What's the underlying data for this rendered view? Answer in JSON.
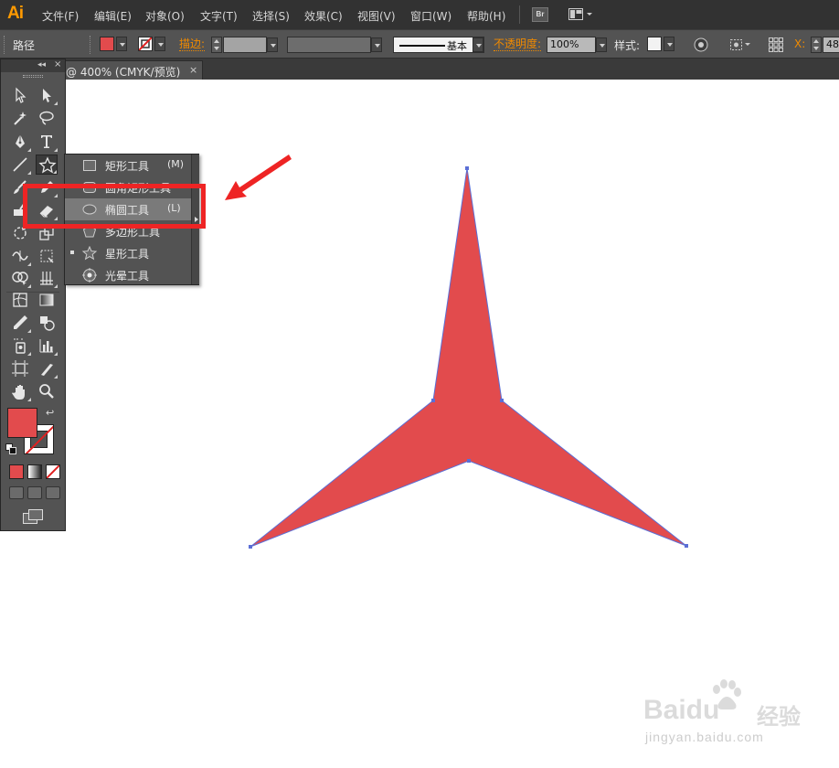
{
  "app": {
    "logo": "Ai"
  },
  "menubar": {
    "items": [
      "文件(F)",
      "编辑(E)",
      "对象(O)",
      "文字(T)",
      "选择(S)",
      "效果(C)",
      "视图(V)",
      "窗口(W)",
      "帮助(H)"
    ],
    "bridge_label": "Br"
  },
  "controlbar": {
    "selection_type": "路径",
    "fill_color": "#e24b4d",
    "stroke_label": "描边:",
    "stroke_profile": "基本",
    "opacity_label": "不透明度:",
    "opacity_value": "100%",
    "style_label": "样式:",
    "x_label": "X:",
    "x_value": "48"
  },
  "document": {
    "tab_title": "@ 400% (CMYK/预览)",
    "tab_close": "×"
  },
  "toolpanel": {
    "collapse": "◂◂",
    "close": "×",
    "fill_color": "#e24b4d",
    "tools": [
      "selection-tool",
      "direct-selection-tool",
      "magic-wand-tool",
      "lasso-tool",
      "pen-tool",
      "type-tool",
      "line-segment-tool",
      "star-tool",
      "paintbrush-tool",
      "pencil-tool",
      "blob-brush-tool",
      "eraser-tool",
      "rotate-tool",
      "scale-tool",
      "width-tool",
      "free-transform-tool",
      "shape-builder-tool",
      "graph-tool",
      "mesh-tool",
      "gradient-tool",
      "eyedropper-tool",
      "blend-tool",
      "symbol-sprayer-tool",
      "column-graph-tool",
      "artboard-tool",
      "slice-tool",
      "hand-tool",
      "zoom-tool"
    ]
  },
  "flyout": {
    "items": [
      {
        "label": "矩形工具",
        "shortcut": "(M)",
        "icon": "rectangle-icon"
      },
      {
        "label": "圆角矩形工具",
        "shortcut": "",
        "icon": "rounded-rectangle-icon"
      },
      {
        "label": "椭圆工具",
        "shortcut": "(L)",
        "icon": "ellipse-icon"
      },
      {
        "label": "多边形工具",
        "shortcut": "",
        "icon": "polygon-icon"
      },
      {
        "label": "星形工具",
        "shortcut": "",
        "icon": "star-icon"
      },
      {
        "label": "光晕工具",
        "shortcut": "",
        "icon": "flare-icon"
      }
    ],
    "highlighted_index": 2,
    "active_index": 4
  },
  "canvas": {
    "shape": "three-pointed-star",
    "fill": "#e24b4d",
    "stroke": "#5b6fd6"
  },
  "annotation": {
    "highlight_color": "#ee2424"
  },
  "watermark": {
    "brand": "Baidu",
    "jingyan": "经验",
    "url": "jingyan.baidu.com"
  }
}
